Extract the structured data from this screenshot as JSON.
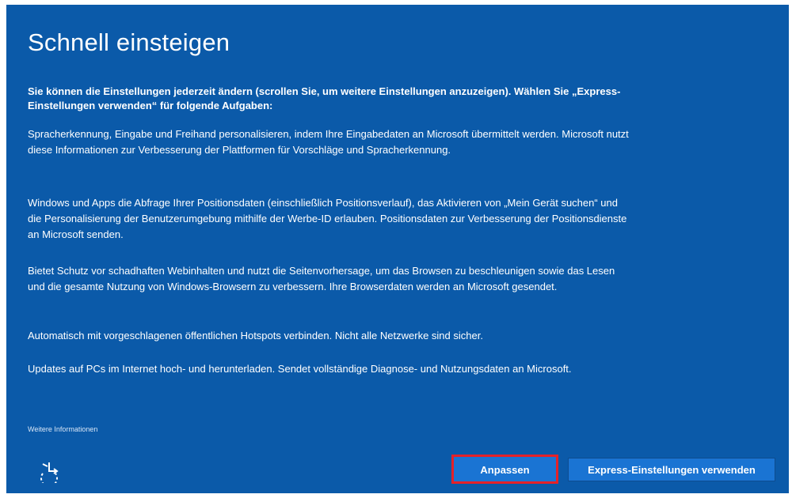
{
  "title": "Schnell einsteigen",
  "intro": "Sie können die Einstellungen jederzeit ändern (scrollen Sie, um weitere Einstellungen anzuzeigen). Wählen Sie „Express-Einstellungen verwenden“ für folgende Aufgaben:",
  "paragraphs": [
    "Spracherkennung, Eingabe und Freihand personalisieren, indem Ihre Eingabedaten an Microsoft übermittelt werden. Microsoft nutzt diese Informationen zur Verbesserung der Plattformen für Vorschläge und Spracherkennung.",
    "Windows und Apps die Abfrage Ihrer Positionsdaten (einschließlich Positionsverlauf), das Aktivieren von „Mein Gerät suchen“ und die Personalisierung der Benutzerumgebung mithilfe der Werbe-ID erlauben. Positionsdaten zur Verbesserung der Positionsdienste an Microsoft senden.",
    "Bietet Schutz vor schadhaften Webinhalten und nutzt die Seitenvorhersage, um das Browsen zu beschleunigen sowie das Lesen und die gesamte Nutzung von Windows-Browsern zu verbessern. Ihre Browserdaten werden an Microsoft gesendet.",
    "Automatisch mit vorgeschlagenen öffentlichen Hotspots verbinden. Nicht alle Netzwerke sind sicher.",
    "Updates auf PCs im Internet hoch- und herunterladen. Sendet vollständige Diagnose- und Nutzungsdaten an Microsoft."
  ],
  "more_info": "Weitere Informationen",
  "buttons": {
    "customize": "Anpassen",
    "express": "Express-Einstellungen verwenden"
  },
  "icons": {
    "accessibility": "ease-of-access-icon"
  },
  "colors": {
    "background": "#0b5aa9",
    "button": "#1a74d3",
    "highlight": "#e52128"
  }
}
